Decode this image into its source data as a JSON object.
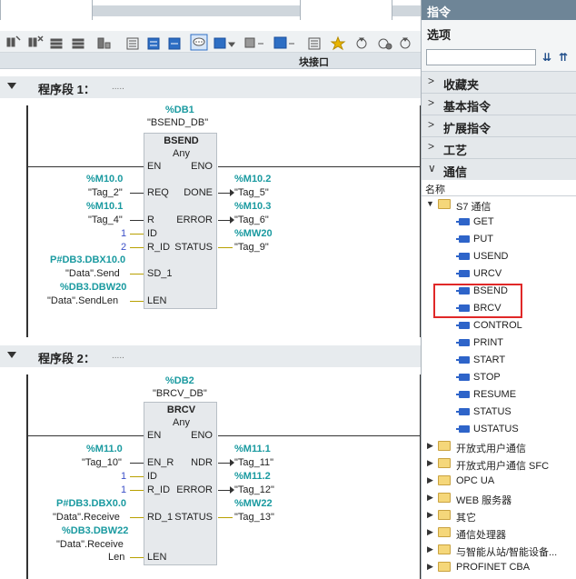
{
  "toolbar": {
    "icons": [
      "insert-network-icon",
      "delete-network-icon",
      "insert-row-icon",
      "add-row-icon",
      "absolute-operands-icon",
      "network-overview-icon",
      "expand-all-icon",
      "collapse-all-icon",
      "comment-icon",
      "favorites-icon",
      "insert-empty-box-icon",
      "open-branch-icon",
      "close-branch-icon",
      "jump-icon",
      "show-all-icon",
      "monitor-icon",
      "monitor-modify-icon"
    ]
  },
  "interface_bar": {
    "label": "块接口"
  },
  "networks": [
    {
      "title": "程序段 1：",
      "comment": ".....",
      "instance_db": "%DB1",
      "instance_name": "\"BSEND_DB\"",
      "block_name": "BSEND",
      "block_type": "Any",
      "pins_left": [
        "EN",
        "REQ",
        "R",
        "ID",
        "R_ID",
        "SD_1",
        "LEN"
      ],
      "pins_right": [
        "ENO",
        "DONE",
        "ERROR",
        "STATUS"
      ],
      "inputs": [
        {
          "addr": "%M10.0",
          "tag": "\"Tag_2\""
        },
        {
          "addr": "%M10.1",
          "tag": "\"Tag_4\""
        },
        {
          "addr": "",
          "tag": "1"
        },
        {
          "addr": "",
          "tag": "2"
        },
        {
          "addr": "P#DB3.DBX10.0",
          "tag": "\"Data\".Send"
        },
        {
          "addr": "%DB3.DBW20",
          "tag": "\"Data\".SendLen"
        }
      ],
      "outputs": [
        {
          "addr": "%M10.2",
          "tag": "\"Tag_5\""
        },
        {
          "addr": "%M10.3",
          "tag": "\"Tag_6\""
        },
        {
          "addr": "%MW20",
          "tag": "\"Tag_9\""
        }
      ]
    },
    {
      "title": "程序段 2：",
      "comment": ".....",
      "instance_db": "%DB2",
      "instance_name": "\"BRCV_DB\"",
      "block_name": "BRCV",
      "block_type": "Any",
      "pins_left": [
        "EN",
        "EN_R",
        "ID",
        "R_ID",
        "RD_1",
        "LEN"
      ],
      "pins_right": [
        "ENO",
        "NDR",
        "ERROR",
        "STATUS"
      ],
      "inputs": [
        {
          "addr": "%M11.0",
          "tag": "\"Tag_10\""
        },
        {
          "addr": "",
          "tag": "1"
        },
        {
          "addr": "",
          "tag": "1"
        },
        {
          "addr": "P#DB3.DBX0.0",
          "tag": "\"Data\".Receive"
        },
        {
          "addr": "%DB3.DBW22",
          "tag": "\"Data\".Receive"
        },
        {
          "addr": "",
          "tag": "Len"
        }
      ],
      "outputs": [
        {
          "addr": "%M11.1",
          "tag": "\"Tag_11\""
        },
        {
          "addr": "%M11.2",
          "tag": "\"Tag_12\""
        },
        {
          "addr": "%MW22",
          "tag": "\"Tag_13\""
        }
      ]
    }
  ],
  "panel": {
    "title": "指令",
    "options_title": "选项",
    "search_value": "",
    "categories": [
      "收藏夹",
      "基本指令",
      "扩展指令",
      "工艺",
      "通信"
    ],
    "name_header": "名称",
    "tree": {
      "root_folder": "S7 通信",
      "items": [
        "GET",
        "PUT",
        "USEND",
        "URCV",
        "BSEND",
        "BRCV",
        "CONTROL",
        "PRINT",
        "START",
        "STOP",
        "RESUME",
        "STATUS",
        "USTATUS"
      ],
      "folders": [
        "开放式用户通信",
        "开放式用户通信 SFC",
        "OPC UA",
        "WEB 服务器",
        "其它",
        "通信处理器",
        "与智能从站/智能设备...",
        "PROFINET CBA"
      ]
    },
    "highlighted": [
      "BSEND",
      "BRCV"
    ],
    "highlight_color": "#e02828"
  }
}
